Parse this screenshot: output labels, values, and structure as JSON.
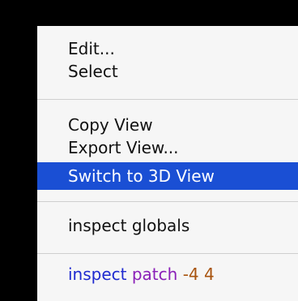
{
  "menu": {
    "items": [
      {
        "label": "Edit..."
      },
      {
        "label": "Select"
      },
      {
        "label": "Copy View"
      },
      {
        "label": "Export View..."
      },
      {
        "label": "Switch to 3D View",
        "highlighted": true
      },
      {
        "label": "inspect globals"
      }
    ],
    "inspect_patch": {
      "verb": "inspect",
      "noun": "patch",
      "coords": "-4 4"
    }
  },
  "colors": {
    "background": "#000000",
    "menu_bg": "#f6f6f6",
    "highlight": "#1a4fd4",
    "separator": "#cfcfcf",
    "inspect_blue": "#1f2ad0",
    "patch_purple": "#8a1fb8",
    "coords_orange": "#a8540f"
  }
}
